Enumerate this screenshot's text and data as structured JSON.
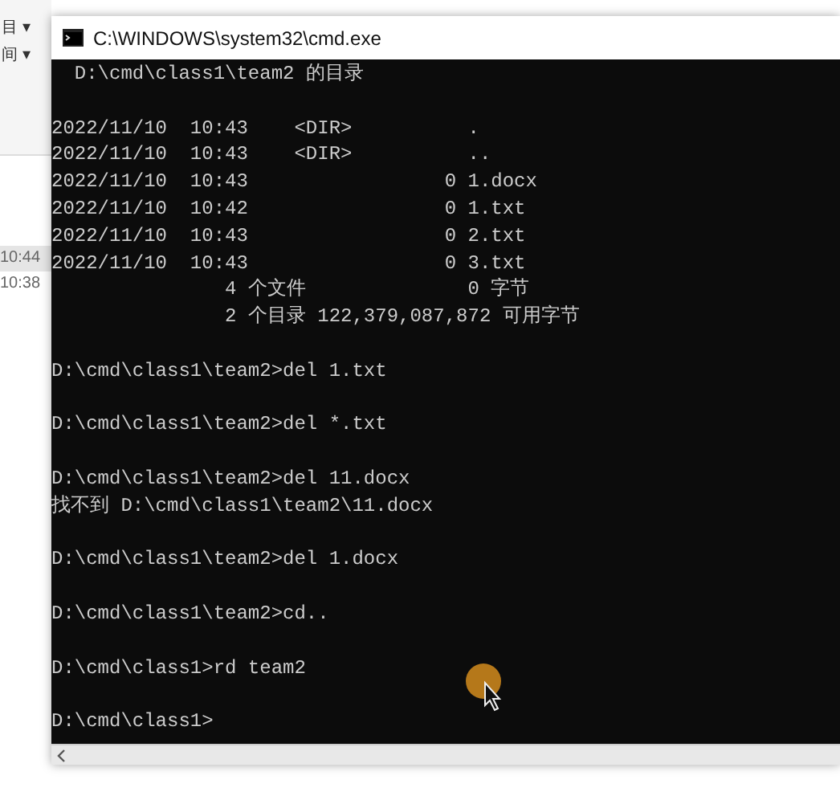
{
  "background_window": {
    "menu_items": [
      "目 ▾",
      "间 ▾"
    ],
    "times": [
      {
        "text": "10:44",
        "selected": true
      },
      {
        "text": "10:38",
        "selected": false
      }
    ]
  },
  "window": {
    "title": "C:\\WINDOWS\\system32\\cmd.exe"
  },
  "console": {
    "blocks": [
      [
        "  D:\\cmd\\class1\\team2 的目录"
      ],
      [
        "2022/11/10  10:43    <DIR>          .",
        "2022/11/10  10:43    <DIR>          ..",
        "2022/11/10  10:43                 0 1.docx",
        "2022/11/10  10:42                 0 1.txt",
        "2022/11/10  10:43                 0 2.txt",
        "2022/11/10  10:43                 0 3.txt",
        "               4 个文件              0 字节",
        "               2 个目录 122,379,087,872 可用字节"
      ],
      [
        "D:\\cmd\\class1\\team2>del 1.txt"
      ],
      [
        "D:\\cmd\\class1\\team2>del *.txt"
      ],
      [
        "D:\\cmd\\class1\\team2>del 11.docx",
        "找不到 D:\\cmd\\class1\\team2\\11.docx"
      ],
      [
        "D:\\cmd\\class1\\team2>del 1.docx"
      ],
      [
        "D:\\cmd\\class1\\team2>cd.."
      ],
      [
        "D:\\cmd\\class1>rd team2"
      ],
      [
        "D:\\cmd\\class1>"
      ]
    ]
  }
}
